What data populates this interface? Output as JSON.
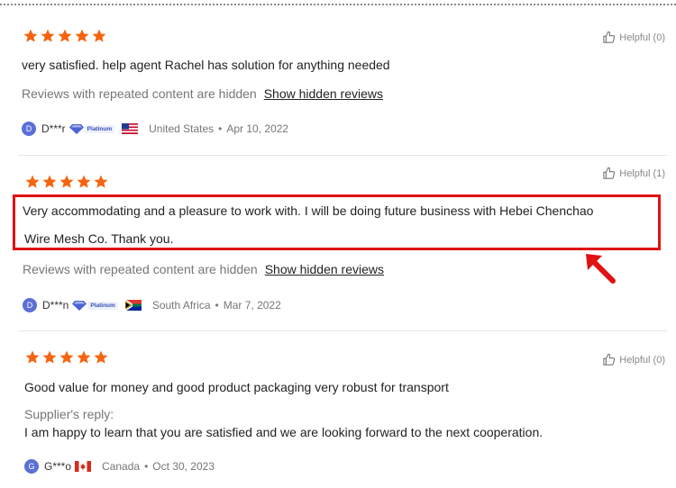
{
  "colors": {
    "star": "#f5640f",
    "highlight": "#e01212",
    "avatar": "#5b6fd6"
  },
  "reviews": [
    {
      "rating": 5,
      "helpful_label": "Helpful (0)",
      "text": "very satisfied. help agent Rachel has solution for anything needed",
      "hidden_notice": "Reviews with repeated content are hidden",
      "hidden_link": "Show hidden reviews",
      "avatar_letter": "D",
      "user": "D***r",
      "badge": "Platinum",
      "flag": "us-flag-icon",
      "country": "United States",
      "date": "Apr 10, 2022"
    },
    {
      "rating": 5,
      "helpful_label": "Helpful (1)",
      "text_line1": "Very accommodating and a pleasure to work with. I will be doing future business with Hebei Chenchao",
      "text_line2": "Wire Mesh Co. Thank you.",
      "hidden_notice": "Reviews with repeated content are hidden",
      "hidden_link": "Show hidden reviews",
      "avatar_letter": "D",
      "user": "D***n",
      "badge": "Platinum",
      "flag": "za-flag-icon",
      "country": "South Africa",
      "date": "Mar 7, 2022"
    },
    {
      "rating": 5,
      "helpful_label": "Helpful (0)",
      "text": "Good value for money and good product packaging very robust for transport",
      "reply_label": "Supplier's reply:",
      "reply_text": "I am happy to learn that you are satisfied and we are looking forward to the next cooperation.",
      "avatar_letter": "G",
      "user": "G***o",
      "flag": "ca-flag-icon",
      "country": "Canada",
      "date": "Oct 30, 2023"
    }
  ],
  "separator": "•"
}
